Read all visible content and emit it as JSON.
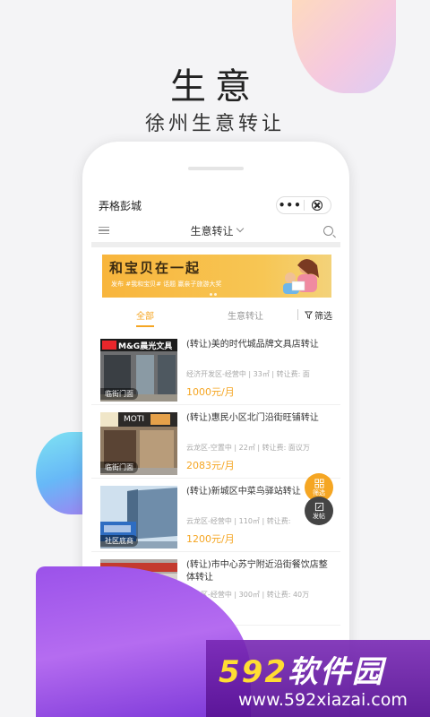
{
  "hero": {
    "title": "生意",
    "subtitle": "徐州生意转让"
  },
  "mini_program": {
    "title": "弄格彭城",
    "capsule_more": "•••"
  },
  "nav": {
    "title": "生意转让"
  },
  "banner": {
    "headline": "和宝贝在一起",
    "subline": "发布 #我和宝贝# 话题 赢亲子旅游大奖"
  },
  "tabs": {
    "all": "全部",
    "transfer": "生意转让",
    "filter": "筛选"
  },
  "listings": [
    {
      "title": "(转让)美的时代城品牌文具店转让",
      "meta": "经济开发区-经营中 | 33㎡ | 转让费: 面",
      "price": "1000元/月",
      "tag": "临街门面",
      "sign": "M&G晨光文具"
    },
    {
      "title": "(转让)惠民小区北门沿街旺铺转让",
      "meta": "云龙区-空置中 | 22㎡ | 转让费: 面议万",
      "price": "2083元/月",
      "tag": "临街门面",
      "sign": "MOTI"
    },
    {
      "title": "(转让)新城区中菜鸟驿站转让",
      "meta": "云龙区-经营中 | 110㎡ | 转让费:",
      "price": "1200元/月",
      "tag": "社区底商",
      "sign": ""
    },
    {
      "title": "(转让)市中心苏宁附近沿街餐饮店整体转让",
      "meta": "泉山区-经营中 | 300㎡ | 转让费: 40万",
      "price": "",
      "tag": "",
      "sign": ""
    }
  ],
  "fabs": {
    "filter": "筛选",
    "post": "发帖"
  },
  "watermark": {
    "brand_num": "592",
    "brand_text": "软件园",
    "url": "www.592xiazai.com"
  },
  "colors": {
    "accent": "#f5a623",
    "watermark": "#5a1a96"
  }
}
